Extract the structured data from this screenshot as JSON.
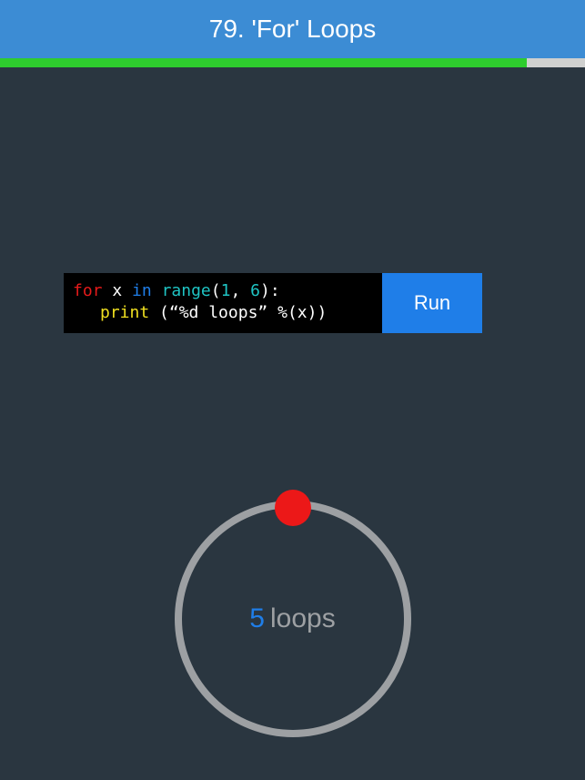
{
  "header": {
    "title": "79. 'For' Loops"
  },
  "progress": {
    "percent": 90
  },
  "code": {
    "tokens_line1": {
      "for": "for",
      "var": "x",
      "in": "in",
      "range": "range",
      "open": "(",
      "a": "1",
      "comma": ", ",
      "b": "6",
      "close": ")",
      "colon": ":"
    },
    "tokens_line2": {
      "print": "print",
      "space": " ",
      "open": "(",
      "str": "“%d loops”",
      "space2": " ",
      "pct": "%",
      "open2": "(",
      "var": "x",
      "close2": ")",
      "close": ")"
    }
  },
  "run": {
    "label": "Run"
  },
  "loop": {
    "count": "5",
    "word": "loops"
  }
}
